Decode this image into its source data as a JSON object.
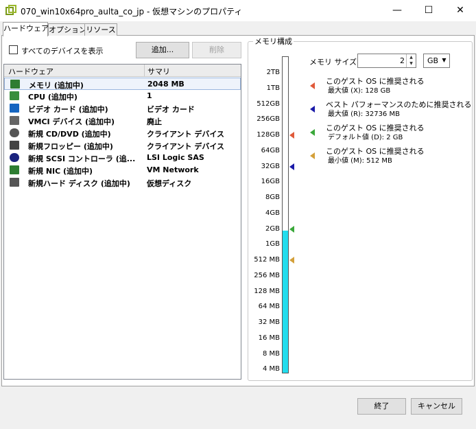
{
  "window": {
    "title": "070_win10x64pro_aulta_co_jp - 仮想マシンのプロパティ",
    "min_glyph": "—",
    "max_glyph": "☐",
    "close_glyph": "✕"
  },
  "tabs": [
    {
      "label": "ハードウェア",
      "active": true
    },
    {
      "label": "オプション",
      "active": false
    },
    {
      "label": "リソース",
      "active": false
    }
  ],
  "hardware": {
    "show_all_label": "すべてのデバイスを表示",
    "add_button": "追加...",
    "remove_button": "削除",
    "col_hardware": "ハードウェア",
    "col_summary": "サマリ",
    "rows": [
      {
        "name": "メモリ (追加中)",
        "summary": "2048 MB",
        "icon": "memory-icon",
        "selected": true
      },
      {
        "name": "CPU (追加中)",
        "summary": "1",
        "icon": "cpu-icon",
        "selected": false
      },
      {
        "name": "ビデオ カード (追加中)",
        "summary": "ビデオ カード",
        "icon": "video-card-icon",
        "selected": false
      },
      {
        "name": "VMCI デバイス (追加中)",
        "summary": "廃止",
        "icon": "vmci-icon",
        "selected": false
      },
      {
        "name": "新規 CD/DVD (追加中)",
        "summary": "クライアント デバイス",
        "icon": "cd-dvd-icon",
        "selected": false
      },
      {
        "name": "新規フロッピー (追加中)",
        "summary": "クライアント デバイス",
        "icon": "floppy-icon",
        "selected": false
      },
      {
        "name": "新規 SCSI コントローラ (追...",
        "summary": "LSI Logic SAS",
        "icon": "scsi-controller-icon",
        "selected": false
      },
      {
        "name": "新規 NIC (追加中)",
        "summary": "VM Network",
        "icon": "nic-icon",
        "selected": false
      },
      {
        "name": "新規ハード ディスク (追加中)",
        "summary": "仮想ディスク",
        "icon": "hard-disk-icon",
        "selected": false
      }
    ]
  },
  "memory": {
    "group_title": "メモリ構成",
    "size_label": "メモリ サイズ:",
    "size_value": "2",
    "unit": "GB",
    "fill_level": 0.45,
    "scale_ticks": [
      "2TB",
      "1TB",
      "512GB",
      "256GB",
      "128GB",
      "64GB",
      "32GB",
      "16GB",
      "8GB",
      "4GB",
      "2GB",
      "1GB",
      "512 MB",
      "256 MB",
      "128 MB",
      "64 MB",
      "32 MB",
      "16 MB",
      "8 MB",
      "4 MB"
    ],
    "markers": [
      {
        "tick": "128GB",
        "color": "#e05a3a"
      },
      {
        "tick": "32GB",
        "color": "#1a1aa8"
      },
      {
        "tick": "2GB",
        "color": "#3aa83a"
      },
      {
        "tick": "512 MB",
        "color": "#d4a03a"
      }
    ],
    "legend": [
      {
        "line1": "このゲスト OS に推奨される",
        "line2": "最大値 (X): 128 GB",
        "color": "#e05a3a"
      },
      {
        "line1": "ベスト パフォーマンスのために推奨される",
        "line2": "最大値 (R): 32736 MB",
        "color": "#1a1aa8"
      },
      {
        "line1": "このゲスト OS に推奨される",
        "line2": "デフォルト値 (D): 2 GB",
        "color": "#3aa83a"
      },
      {
        "line1": "このゲスト OS に推奨される",
        "line2": "最小値 (M): 512 MB",
        "color": "#d4a03a"
      }
    ]
  },
  "footer": {
    "finish_button": "終了",
    "cancel_button": "キャンセル"
  }
}
